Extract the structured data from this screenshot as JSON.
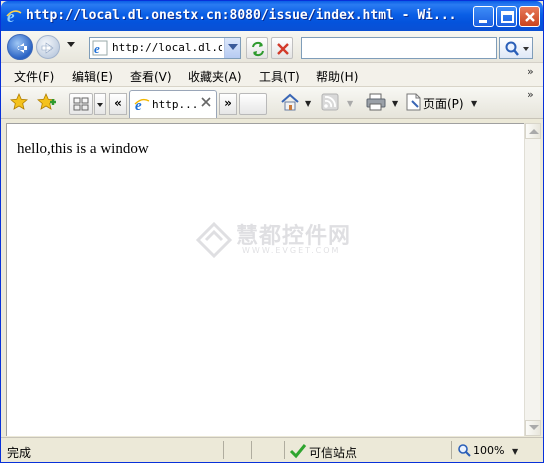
{
  "window": {
    "title": "http://local.dl.onestx.cn:8080/issue/index.html - Wi..."
  },
  "address_bar": {
    "value": "http://local.dl.onestx.cn:8080/issue/index.html"
  },
  "search": {
    "value": ""
  },
  "menu": {
    "items": [
      "文件(F)",
      "编辑(E)",
      "查看(V)",
      "收藏夹(A)",
      "工具(T)",
      "帮助(H)"
    ]
  },
  "tabs": [
    {
      "label": "http..."
    }
  ],
  "command_bar": {
    "page_label": "页面(P)",
    "overflow": "»",
    "menu_overflow": "»",
    "scroll_left": "«",
    "scroll_right": "»"
  },
  "content": {
    "text": "hello,this is a window",
    "watermark_cn": "慧都控件网",
    "watermark_en": "WWW.EVGET.COM"
  },
  "status_bar": {
    "status": "完成",
    "zone": "可信站点",
    "zoom": "100%"
  },
  "colors": {
    "title_bar": "#0a5fe6",
    "content_bg": "#ffffff",
    "chrome_bg": "#ece9d8"
  }
}
